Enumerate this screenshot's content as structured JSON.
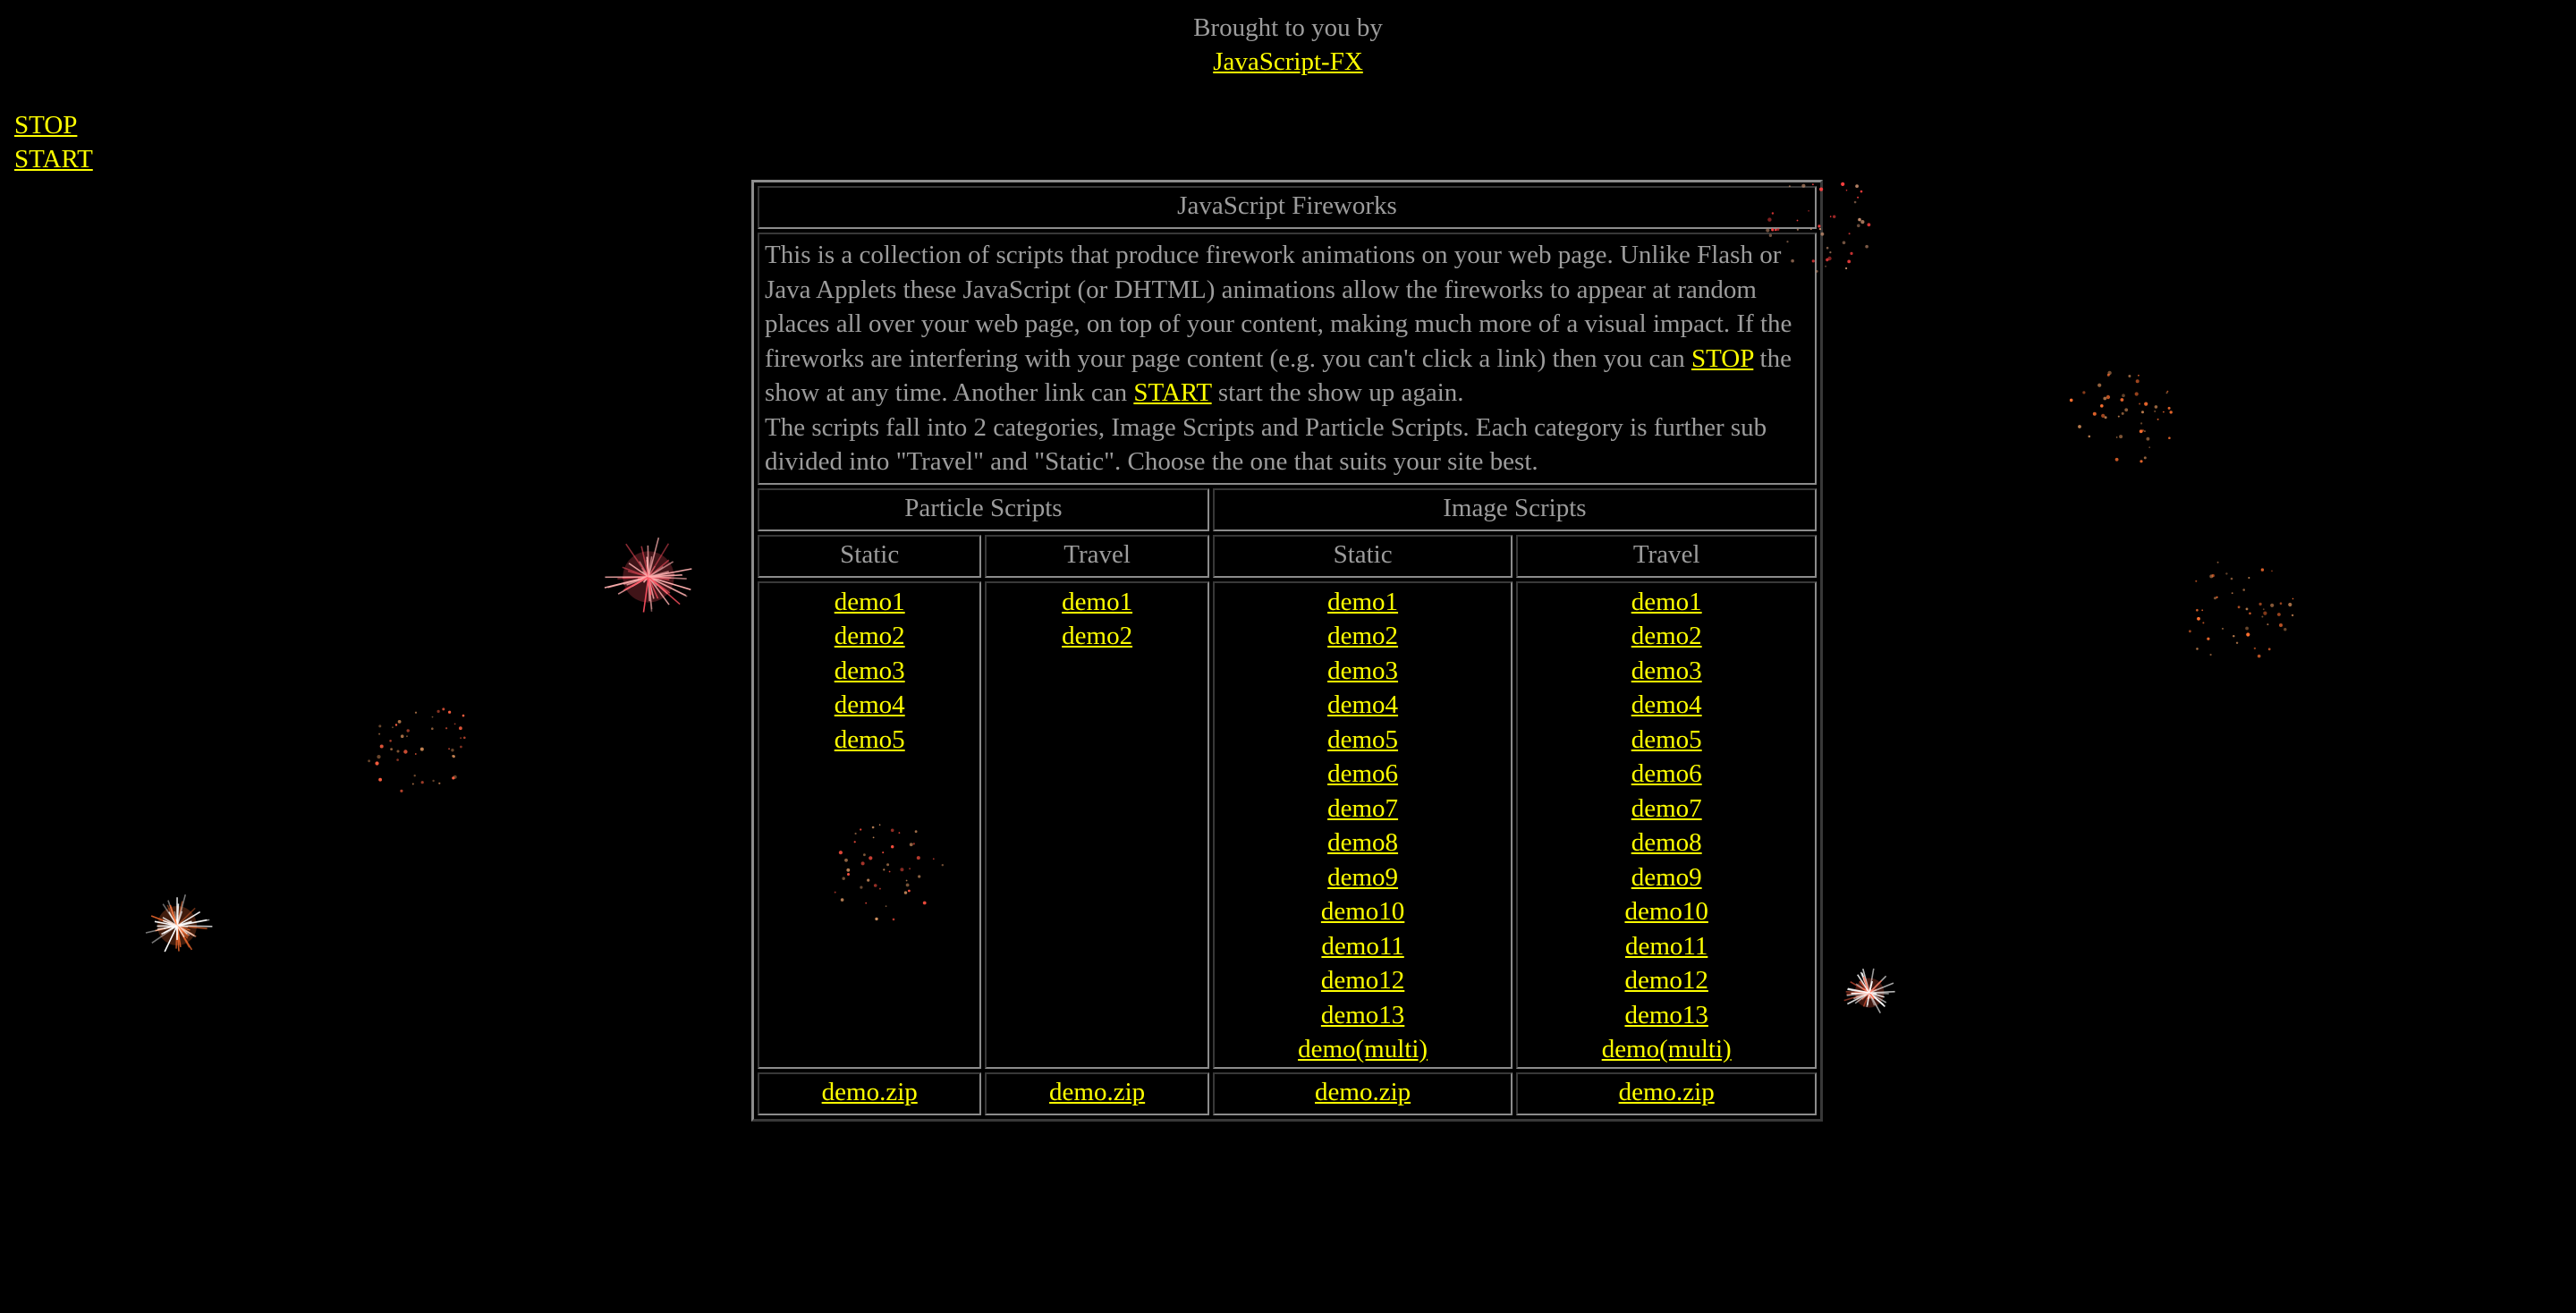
{
  "credit": {
    "line1": "Brought to you by",
    "link": "JavaScript-FX"
  },
  "controls": {
    "stop": "STOP",
    "start": "START"
  },
  "table": {
    "title": "JavaScript Fireworks",
    "intro": {
      "p1_a": "This is a collection of scripts that produce firework animations on your web page. Unlike Flash or Java Applets these JavaScript (or DHTML) animations allow the fireworks to appear at random places all over your web page, on top of your content, making much more of a visual impact. If the fireworks are interfering with your page content (e.g. you can't click a link) then you can ",
      "p1_stop": "STOP",
      "p1_b": " the show at any time. Another link can ",
      "p1_start": "START",
      "p1_c": " start the show up again.",
      "p2": "The scripts fall into 2 categories, Image Scripts and Particle Scripts. Each category is further sub divided into \"Travel\" and \"Static\". Choose the one that suits your site best."
    },
    "groups": {
      "particle": "Particle Scripts",
      "image": "Image Scripts"
    },
    "subheads": {
      "particle_static": "Static",
      "particle_travel": "Travel",
      "image_static": "Static",
      "image_travel": "Travel"
    },
    "particle_static": [
      "demo1",
      "demo2",
      "demo3",
      "demo4",
      "demo5"
    ],
    "particle_travel": [
      "demo1",
      "demo2"
    ],
    "image_static": [
      "demo1",
      "demo2",
      "demo3",
      "demo4",
      "demo5",
      "demo6",
      "demo7",
      "demo8",
      "demo9",
      "demo10",
      "demo11",
      "demo12",
      "demo13",
      "demo(multi)"
    ],
    "image_travel": [
      "demo1",
      "demo2",
      "demo3",
      "demo4",
      "demo5",
      "demo6",
      "demo7",
      "demo8",
      "demo9",
      "demo10",
      "demo11",
      "demo12",
      "demo13",
      "demo(multi)"
    ],
    "zip": {
      "particle_static": "demo.zip",
      "particle_travel": "demo.zip",
      "image_static": "demo.zip",
      "image_travel": "demo.zip"
    }
  },
  "colors": {
    "background": "#000000",
    "text": "#9c9c9c",
    "link": "#ffff00",
    "border": "#8c8c8c"
  }
}
